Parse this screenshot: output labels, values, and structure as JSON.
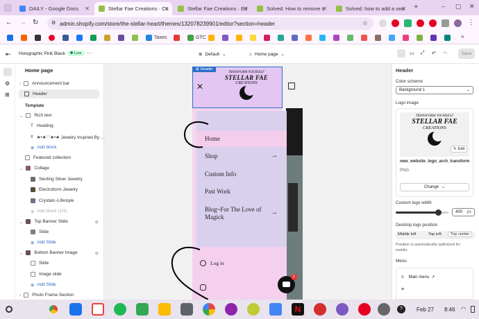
{
  "tabs": [
    {
      "label": "DAILY - Google Docs",
      "color": "#4285f4",
      "active": false
    },
    {
      "label": "Stellar Fae Creations · Cu",
      "color": "#95bf47",
      "active": true
    },
    {
      "label": "Stellar Fae Creations · Ed",
      "color": "#95bf47",
      "active": false
    },
    {
      "label": "Solved: How to remove s",
      "color": "#95bf47",
      "active": false
    },
    {
      "label": "Solved: how to add a sea",
      "color": "#95bf47",
      "active": false
    }
  ],
  "address": "admin.shopify.com/store/the-stellar-heart/themes/132078239901/editor?section=header",
  "bookmarks": {
    "taxes": "Taxes",
    "gtc": "GTC"
  },
  "theme": {
    "name": "Holographic Pink Black",
    "live": "Live",
    "default_label": "Default",
    "page_label": "Home page",
    "save": "Save"
  },
  "left": {
    "title": "Home page",
    "announcement": "Announcement bar",
    "header": "Header",
    "template": "Template",
    "rich_text": "Rich text",
    "heading": "Heading",
    "jewelry": "★•★♡★•★ Jewelry Inspired By ...",
    "add_block": "Add block",
    "featured": "Featured collection",
    "collage": "Collage",
    "sterling": "Sterling Silver Jewelry",
    "electroform": "Electroform Jewelry",
    "crystals": "Crystals~Lifestyle",
    "add_block_13": "Add block (1/3)",
    "top_banner": "Top Banner Slide",
    "slide": "Slide",
    "add_slide": "Add Slide",
    "bottom_banner": "Bottom Banner Image",
    "slide2": "Slide",
    "image_slide": "Image slide",
    "add_slide2": "Add Slide",
    "photo_frame": "Photo Frame Section"
  },
  "preview": {
    "header_tag": "Header",
    "logo_top": "TRANSFORM YOURSELF",
    "logo_main": "STELLAR FAE",
    "logo_sub": "CREATIONS",
    "menu": [
      "Home",
      "Shop",
      "Custom Info",
      "Past Work",
      "Blog~For The Love of Magick"
    ],
    "login": "Log in",
    "chat_badge": "1"
  },
  "right": {
    "title": "Header",
    "color_scheme": "Color scheme",
    "scheme_value": "Background 1",
    "logo_image": "Logo image",
    "edit": "Edit",
    "filename": "new_website_logo_arch_transform",
    "filetype": "PNG",
    "change": "Change",
    "logo_width": "Custom logo width",
    "logo_width_value": "400",
    "logo_width_unit": "px",
    "logo_width_fraction": 0.8,
    "desktop_pos": "Desktop logo position",
    "pos_options": [
      "Middle left",
      "Top left",
      "Top center"
    ],
    "pos_note": "Position is automatically optimized for mobile.",
    "menu": "Menu",
    "main_menu": "Main menu"
  },
  "taskbar": {
    "date": "Feb 27",
    "time": "8:46"
  }
}
